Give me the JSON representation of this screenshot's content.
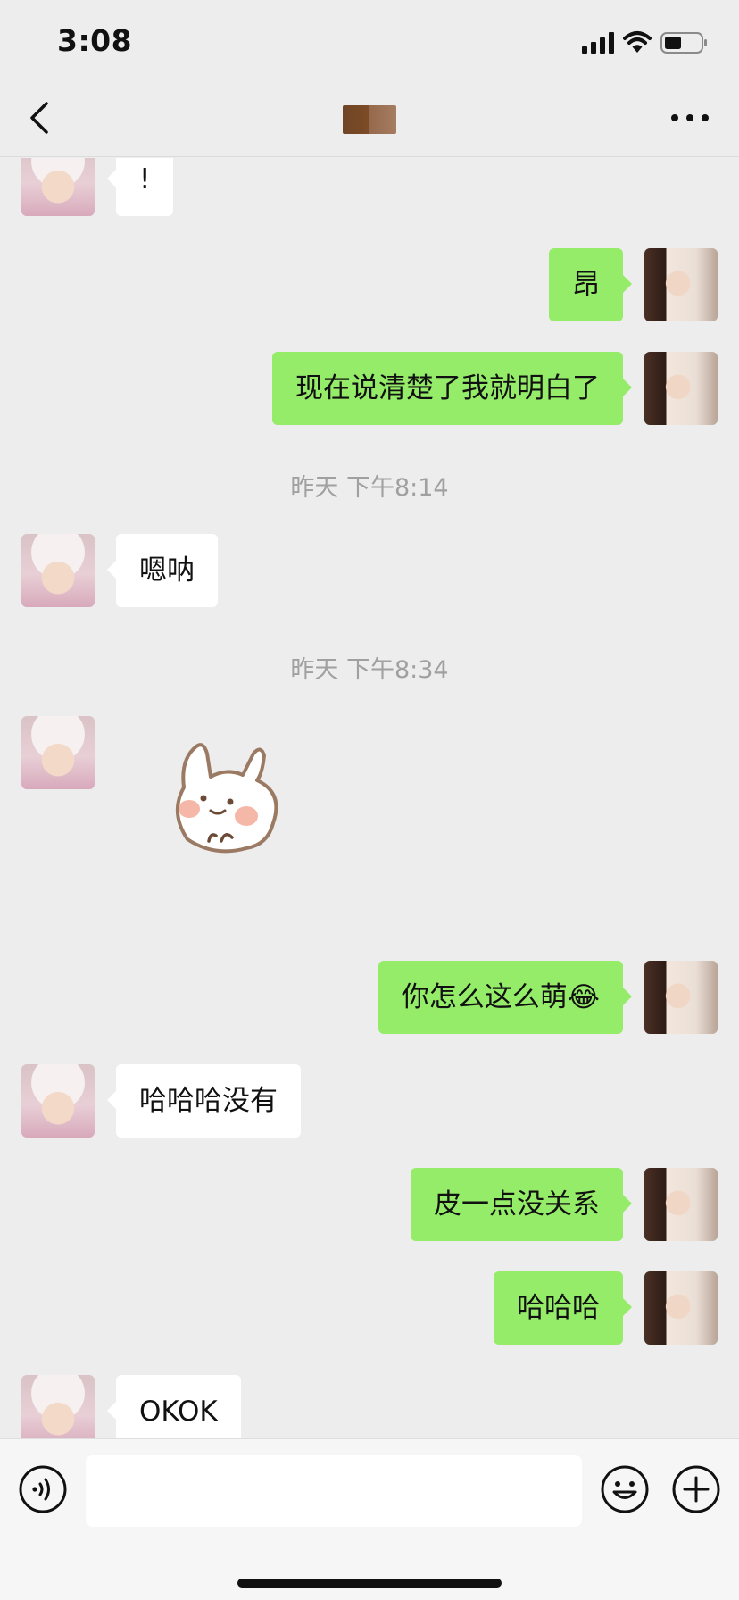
{
  "status_bar": {
    "time": "3:08"
  },
  "header": {
    "contact_name": "",
    "back_icon": "chevron-left-icon",
    "more_icon": "ellipsis-icon"
  },
  "colors": {
    "background": "#ededed",
    "sent_bubble": "#95ec69",
    "received_bubble": "#ffffff",
    "timestamp": "#a0a0a0"
  },
  "messages": [
    {
      "side": "left",
      "text": "!"
    },
    {
      "side": "right",
      "text": "昂"
    },
    {
      "side": "right",
      "text": "现在说清楚了我就明白了"
    },
    {
      "type": "timestamp",
      "text": "昨天 下午8:14"
    },
    {
      "side": "left",
      "text": "嗯呐"
    },
    {
      "type": "timestamp",
      "text": "昨天 下午8:34"
    },
    {
      "side": "left",
      "type": "sticker",
      "sticker": "bunny-sticker"
    },
    {
      "side": "right",
      "text": "你怎么这么萌",
      "emoji": "😂"
    },
    {
      "side": "left",
      "text": "哈哈哈没有"
    },
    {
      "side": "right",
      "text": "皮一点没关系"
    },
    {
      "side": "right",
      "text": "哈哈哈"
    },
    {
      "side": "left",
      "text": "OKOK"
    }
  ],
  "input_bar": {
    "message_value": "",
    "voice_icon": "voice-icon",
    "emoji_icon": "smiley-icon",
    "plus_icon": "plus-circle-icon"
  }
}
